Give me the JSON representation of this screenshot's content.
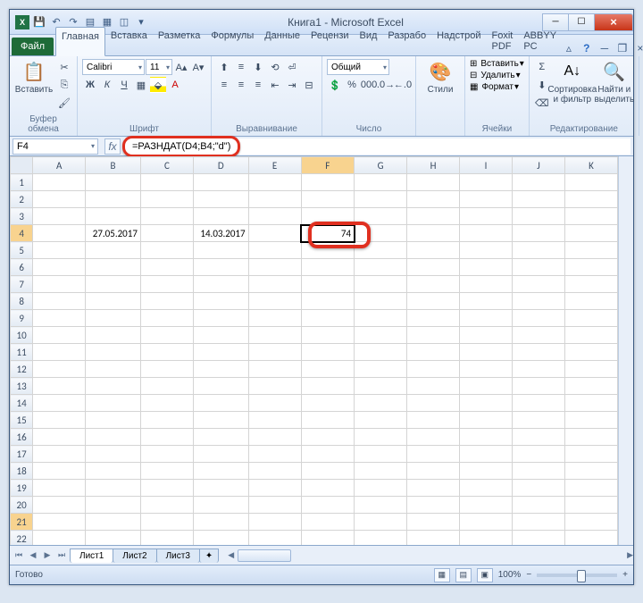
{
  "title": "Книга1 - Microsoft Excel",
  "tabs": {
    "file": "Файл",
    "list": [
      "Главная",
      "Вставка",
      "Разметка",
      "Формулы",
      "Данные",
      "Рецензи",
      "Вид",
      "Разрабо",
      "Надстрой",
      "Foxit PDF",
      "ABBYY PC"
    ],
    "active": 0
  },
  "ribbon": {
    "paste": "Вставить",
    "clipboard_label": "Буфер обмена",
    "font_name": "Calibri",
    "font_size": "11",
    "font_label": "Шрифт",
    "align_label": "Выравнивание",
    "number_format": "Общий",
    "number_label": "Число",
    "styles": "Стили",
    "insert": "Вставить",
    "delete": "Удалить",
    "format": "Формат",
    "cells_label": "Ячейки",
    "sort": "Сортировка и фильтр",
    "find": "Найти и выделить",
    "edit_label": "Редактирование"
  },
  "namebox": "F4",
  "formula": "=РАЗНДАТ(D4;B4;\"d\")",
  "cells": {
    "B4": "27.05.2017",
    "D4": "14.03.2017",
    "F4": "74"
  },
  "columns": [
    "A",
    "B",
    "C",
    "D",
    "E",
    "F",
    "G",
    "H",
    "I",
    "J",
    "K"
  ],
  "rows_count": 24,
  "active_col": "F",
  "active_row": 4,
  "highlight_row": 21,
  "sheets": [
    "Лист1",
    "Лист2",
    "Лист3"
  ],
  "active_sheet": 0,
  "status": "Готово",
  "zoom": "100%"
}
